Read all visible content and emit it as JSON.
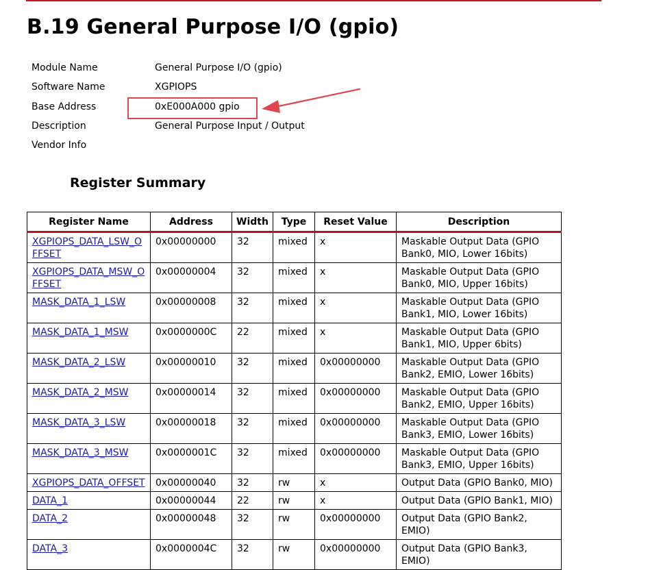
{
  "heading": "B.19  General Purpose I/O (gpio)",
  "info": [
    {
      "key": "Module Name",
      "value": "General Purpose I/O (gpio)"
    },
    {
      "key": "Software Name",
      "value": "XGPIOPS"
    },
    {
      "key": "Base Address",
      "value": "0xE000A000 gpio"
    },
    {
      "key": "Description",
      "value": "General Purpose Input / Output"
    },
    {
      "key": "Vendor Info",
      "value": ""
    }
  ],
  "summary_title": "Register Summary",
  "columns": [
    "Register Name",
    "Address",
    "Width",
    "Type",
    "Reset Value",
    "Description"
  ],
  "rows": [
    {
      "name": "XGPIOPS_DATA_LSW_OFFSET",
      "address": "0x00000000",
      "width": "32",
      "type": "mixed",
      "reset": "x",
      "desc": "Maskable Output Data (GPIO Bank0, MIO, Lower 16bits)"
    },
    {
      "name": "XGPIOPS_DATA_MSW_OFFSET",
      "address": "0x00000004",
      "width": "32",
      "type": "mixed",
      "reset": "x",
      "desc": "Maskable Output Data (GPIO Bank0, MIO, Upper 16bits)"
    },
    {
      "name": "MASK_DATA_1_LSW",
      "address": "0x00000008",
      "width": "32",
      "type": "mixed",
      "reset": "x",
      "desc": "Maskable Output Data (GPIO Bank1, MIO, Lower 16bits)"
    },
    {
      "name": "MASK_DATA_1_MSW",
      "address": "0x0000000C",
      "width": "22",
      "type": "mixed",
      "reset": "x",
      "desc": "Maskable Output Data (GPIO Bank1, MIO, Upper 6bits)"
    },
    {
      "name": "MASK_DATA_2_LSW",
      "address": "0x00000010",
      "width": "32",
      "type": "mixed",
      "reset": "0x00000000",
      "desc": "Maskable Output Data (GPIO Bank2, EMIO, Lower 16bits)"
    },
    {
      "name": "MASK_DATA_2_MSW",
      "address": "0x00000014",
      "width": "32",
      "type": "mixed",
      "reset": "0x00000000",
      "desc": "Maskable Output Data (GPIO Bank2, EMIO, Upper 16bits)"
    },
    {
      "name": "MASK_DATA_3_LSW",
      "address": "0x00000018",
      "width": "32",
      "type": "mixed",
      "reset": "0x00000000",
      "desc": "Maskable Output Data (GPIO Bank3, EMIO, Lower 16bits)"
    },
    {
      "name": "MASK_DATA_3_MSW",
      "address": "0x0000001C",
      "width": "32",
      "type": "mixed",
      "reset": "0x00000000",
      "desc": "Maskable Output Data (GPIO Bank3, EMIO, Upper 16bits)"
    },
    {
      "name": "XGPIOPS_DATA_OFFSET",
      "address": "0x00000040",
      "width": "32",
      "type": "rw",
      "reset": "x",
      "desc": "Output Data (GPIO Bank0, MIO)"
    },
    {
      "name": "DATA_1",
      "address": "0x00000044",
      "width": "22",
      "type": "rw",
      "reset": "x",
      "desc": "Output Data (GPIO Bank1, MIO)"
    },
    {
      "name": "DATA_2",
      "address": "0x00000048",
      "width": "32",
      "type": "rw",
      "reset": "0x00000000",
      "desc": "Output Data (GPIO Bank2, EMIO)"
    },
    {
      "name": "DATA_3",
      "address": "0x0000004C",
      "width": "32",
      "type": "rw",
      "reset": "0x00000000",
      "desc": "Output Data (GPIO Bank3, EMIO)"
    }
  ],
  "colors": {
    "accent_red": "#c4161c",
    "highlight": "#e0474c",
    "link": "#1a1aa6"
  }
}
